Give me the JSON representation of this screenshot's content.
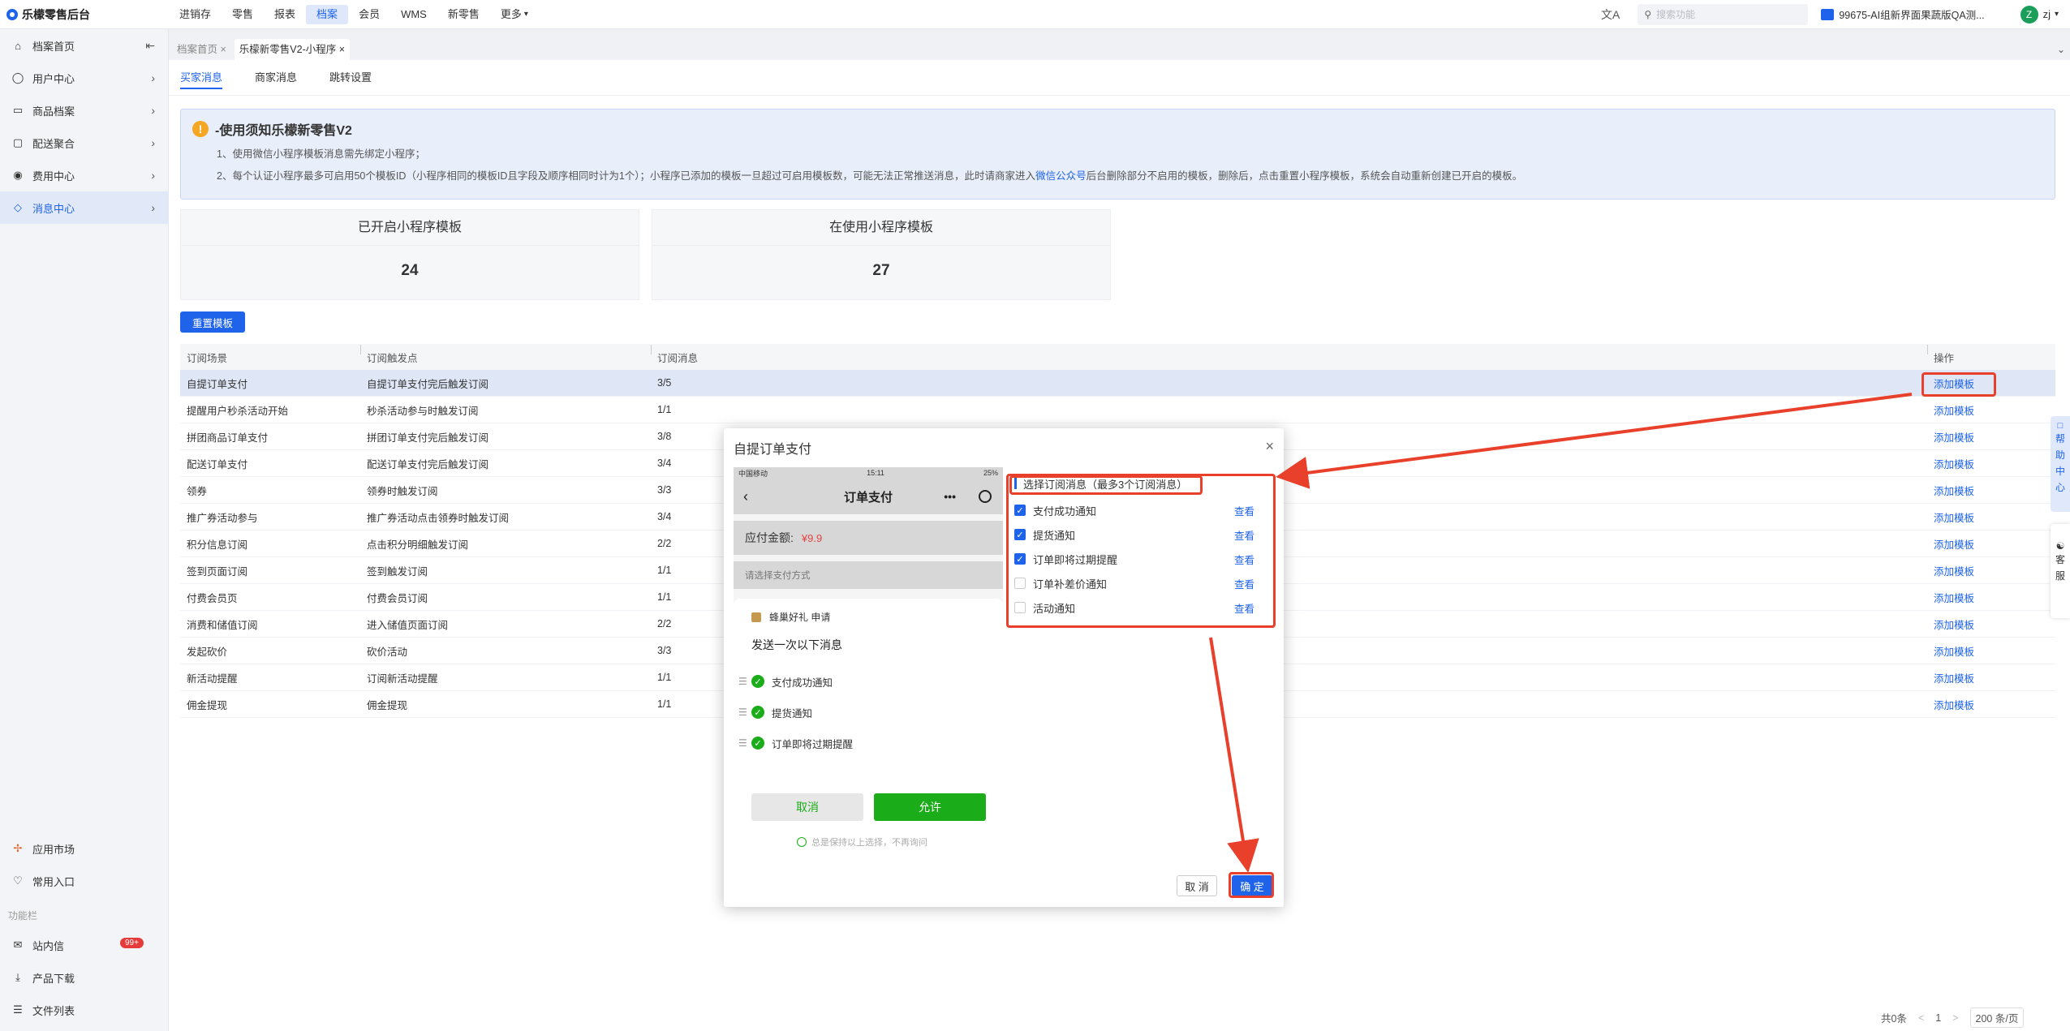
{
  "app": {
    "title": "乐檬零售后台"
  },
  "topnav": [
    "进销存",
    "零售",
    "报表",
    "档案",
    "会员",
    "WMS",
    "新零售",
    "更多"
  ],
  "topnav_active": 3,
  "search": {
    "placeholder": "搜索功能"
  },
  "store": "99675-AI组新界面果蔬版QA测...",
  "user": {
    "initial": "Z",
    "name": "zj"
  },
  "sidebar": {
    "items": [
      {
        "label": "档案首页",
        "icon": "home-icon"
      },
      {
        "label": "用户中心",
        "icon": "user-icon"
      },
      {
        "label": "商品档案",
        "icon": "box-icon"
      },
      {
        "label": "配送聚合",
        "icon": "truck-icon"
      },
      {
        "label": "费用中心",
        "icon": "coin-icon"
      },
      {
        "label": "消息中心",
        "icon": "bell-icon"
      }
    ],
    "active": 5,
    "bottom_items": [
      {
        "label": "应用市场",
        "icon": "apps-icon"
      },
      {
        "label": "常用入口",
        "icon": "heart-icon"
      }
    ],
    "category": "功能栏",
    "func_items": [
      {
        "label": "站内信",
        "icon": "mail-icon",
        "badge": "99+"
      },
      {
        "label": "产品下载",
        "icon": "download-icon"
      },
      {
        "label": "文件列表",
        "icon": "file-list-icon"
      }
    ]
  },
  "page_tabs": [
    {
      "label": "档案首页 ×"
    },
    {
      "label": "乐檬新零售V2-小程序 ×"
    }
  ],
  "sub_tabs": [
    "买家消息",
    "商家消息",
    "跳转设置"
  ],
  "notice": {
    "title": "-使用须知乐檬新零售V2",
    "line1": "1、使用微信小程序模板消息需先绑定小程序；",
    "line2_a": "2、每个认证小程序最多可启用50个模板ID（小程序相同的模板ID且字段及顺序相同时计为1个）；小程序已添加的模板一旦超过可启用模板数，可能无法正常推送消息，此时请商家进入",
    "line2_link": "微信公众号",
    "line2_b": "后台删除部分不启用的模板，删除后，点击重置小程序模板，系统会自动重新创建已开启的模板。"
  },
  "stats": [
    {
      "title": "已开启小程序模板",
      "value": "24"
    },
    {
      "title": "在使用小程序模板",
      "value": "27"
    }
  ],
  "reset_button": "重置模板",
  "table": {
    "headers": [
      "订阅场景",
      "订阅触发点",
      "订阅消息",
      "操作"
    ],
    "rows": [
      {
        "scene": "自提订单支付",
        "trigger": "自提订单支付完后触发订阅",
        "count": "3/5",
        "action": "添加模板"
      },
      {
        "scene": "提醒用户秒杀活动开始",
        "trigger": "秒杀活动参与时触发订阅",
        "count": "1/1",
        "action": "添加模板"
      },
      {
        "scene": "拼团商品订单支付",
        "trigger": "拼团订单支付完后触发订阅",
        "count": "3/8",
        "action": "添加模板"
      },
      {
        "scene": "配送订单支付",
        "trigger": "配送订单支付完后触发订阅",
        "count": "3/4",
        "action": "添加模板"
      },
      {
        "scene": "领券",
        "trigger": "领券时触发订阅",
        "count": "3/3",
        "action": "添加模板"
      },
      {
        "scene": "推广券活动参与",
        "trigger": "推广券活动点击领券时触发订阅",
        "count": "3/4",
        "action": "添加模板"
      },
      {
        "scene": "积分信息订阅",
        "trigger": "点击积分明细触发订阅",
        "count": "2/2",
        "action": "添加模板"
      },
      {
        "scene": "签到页面订阅",
        "trigger": "签到触发订阅",
        "count": "1/1",
        "action": "添加模板"
      },
      {
        "scene": "付费会员页",
        "trigger": "付费会员订阅",
        "count": "1/1",
        "action": "添加模板"
      },
      {
        "scene": "消费和储值订阅",
        "trigger": "进入储值页面订阅",
        "count": "2/2",
        "action": "添加模板"
      },
      {
        "scene": "发起砍价",
        "trigger": "砍价活动",
        "count": "3/3",
        "action": "添加模板"
      },
      {
        "scene": "新活动提醒",
        "trigger": "订阅新活动提醒",
        "count": "1/1",
        "action": "添加模板"
      },
      {
        "scene": "佣金提现",
        "trigger": "佣金提现",
        "count": "1/1",
        "action": "添加模板"
      }
    ]
  },
  "pager": {
    "total": "共0条",
    "prev": "<",
    "page": "1",
    "next": ">",
    "size": "200 条/页"
  },
  "modal": {
    "title": "自提订单支付",
    "close": "×",
    "phone": {
      "carrier": "中国移动",
      "time": "15:11",
      "battery": "25%",
      "nav_title": "订单支付",
      "amount_label": "应付金额:",
      "amount": "¥9.9",
      "pay_label": "请选择支付方式",
      "app_name": "蜂巢好礼 申请",
      "sheet_head": "发送一次以下消息",
      "items": [
        "支付成功通知",
        "提货通知",
        "订单即将过期提醒"
      ],
      "cancel": "取消",
      "allow": "允许",
      "keep": "总是保持以上选择，不再询问"
    },
    "select_title": "选择订阅消息（最多3个订阅消息）",
    "options": [
      {
        "label": "支付成功通知",
        "checked": true,
        "view": "查看"
      },
      {
        "label": "提货通知",
        "checked": true,
        "view": "查看"
      },
      {
        "label": "订单即将过期提醒",
        "checked": true,
        "view": "查看"
      },
      {
        "label": "订单补差价通知",
        "checked": false,
        "view": "查看"
      },
      {
        "label": "活动通知",
        "checked": false,
        "view": "查看"
      }
    ],
    "cancel": "取 消",
    "ok": "确 定"
  },
  "float": {
    "help": [
      "帮",
      "助",
      "中",
      "心"
    ],
    "service": [
      "客",
      "服"
    ]
  },
  "colors": {
    "accent": "#1e63e9",
    "annotation": "#e8402a",
    "wechat_green": "#1aad19"
  }
}
